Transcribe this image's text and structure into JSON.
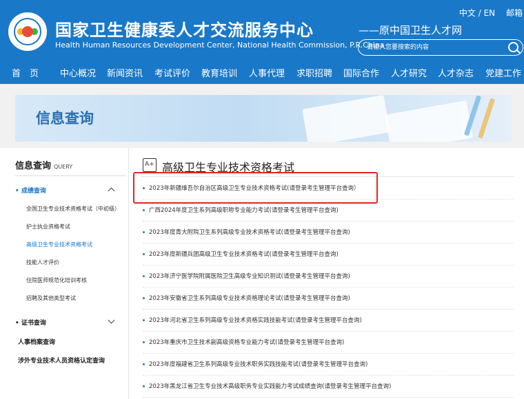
{
  "header": {
    "cn_title": "国家卫生健康委人才交流服务中心",
    "en_title": "Health Human Resources Development Center, National Health Commission, P.R.China",
    "slogan": "——原中国卫生人才网",
    "lang": "中文 / EN",
    "mail": "邮箱",
    "search_placeholder": "请输入您要搜索的内容"
  },
  "nav": [
    "首　页",
    "中心概况",
    "新闻资讯",
    "考试评价",
    "教育培训",
    "人事代理",
    "求职招聘",
    "国际合作",
    "人才研究",
    "人才杂志",
    "党建工作"
  ],
  "banner": {
    "title": "信息查询"
  },
  "sidebar": {
    "title": "信息查询",
    "title_en": "QUERY",
    "cat1": "成绩查询",
    "cat1_items": [
      "全国卫生专业技术资格考试（中初级）",
      "护士执业资格考试",
      "高级卫生专业技术资格考试",
      "技能人才评价",
      "住院医师规范化培训考核",
      "招聘及其他类型考试"
    ],
    "cat2": "证书查询",
    "cat3": "人事档案查询",
    "cat4": "涉外专业技术人员资格认定查询"
  },
  "main": {
    "section_icon": "A+",
    "section_title": "高级卫生专业技术资格考试",
    "items": [
      "2023年新疆维吾尔自治区高级卫生专业技术资格考试(请登录考生管理平台查询）",
      "广西2024年度卫生系列高级职称专业能力考试(请登录考生管理平台查询)",
      "2023年度青大附院卫生系列高级专业技术资格考试(请登录考生管理平台查询)",
      "2023年度新疆兵团高级卫生专业技术资格考试(请登录考生管理平台查询)",
      "2023年济宁医学院附属医院卫生高级专业知识测试(请登录考生管理平台查询)",
      "2023年安徽省卫生系列高级专业技术资格理论考试(请登录考生管理平台查询)",
      "2023年河北省卫生系列高级专业技术资格实践技能考试(请登录考生管理平台查询)",
      "2023年重庆市卫生技术副高级资格专业能力考试(请登录考生管理平台查询)",
      "2023年度福建省卫生系列高级专业技术职务实践技能考试(请登录考生管理平台查询)",
      "2023年黑龙江省卫生专业技术高级职务专业实践能力考试成绩查询(请登录考生管理平台查询)"
    ]
  }
}
